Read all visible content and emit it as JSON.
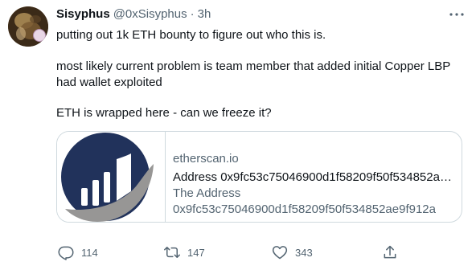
{
  "author": {
    "name": "Sisyphus",
    "handle": "@0xSisyphus",
    "separator": "·",
    "time": "3h"
  },
  "tweet": {
    "line1": "putting out 1k ETH bounty to figure out who this is.",
    "line2": "most likely current problem is team member that added initial Copper LBP had wallet exploited",
    "line3": "ETH is wrapped here - can we freeze it?"
  },
  "card": {
    "domain": "etherscan.io",
    "title": "Address 0x9fc53c75046900d1f58209f50f534852ae9f912a",
    "description_line1": "The Address",
    "description_line2": "0x9fc53c75046900d1f58209f50f534852ae9f912a",
    "logo_colors": {
      "primary": "#21325b",
      "secondary": "#979695"
    }
  },
  "actions": {
    "reply_count": "114",
    "retweet_count": "147",
    "like_count": "343",
    "icons": [
      "reply-icon",
      "retweet-icon",
      "like-icon",
      "share-icon"
    ]
  },
  "colors": {
    "text_primary": "#0f1419",
    "text_secondary": "#536471",
    "border": "#cfd9de"
  }
}
